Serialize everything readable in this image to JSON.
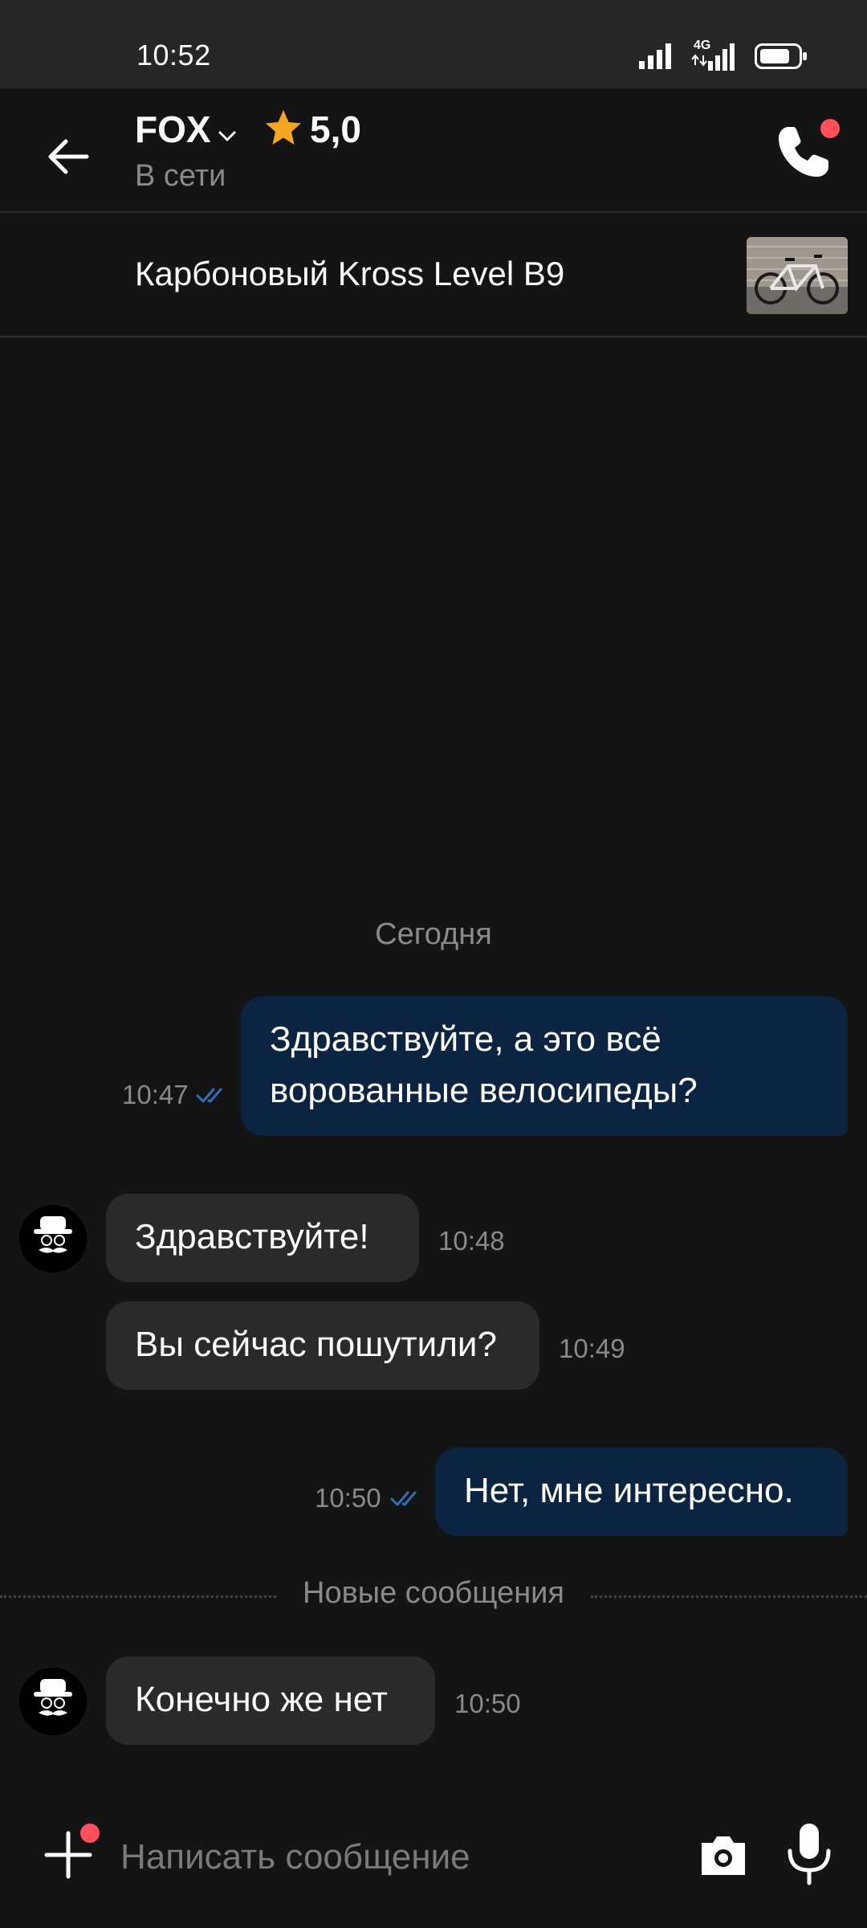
{
  "status_bar": {
    "time": "10:52",
    "network": "4G"
  },
  "header": {
    "seller_name": "FOX",
    "rating": "5,0",
    "status": "В сети",
    "star_color": "#f5a623",
    "notification_dot_color": "#ff4f5a"
  },
  "listing": {
    "title": "Карбоновый Kross Level B9"
  },
  "chat": {
    "day_label": "Сегодня",
    "new_messages_label": "Новые сообщения",
    "messages": [
      {
        "direction": "outgoing",
        "text_line1": "Здравствуйте, а это всё",
        "text_line2": "ворованные велосипеды?",
        "time": "10:47",
        "read": true
      },
      {
        "direction": "incoming",
        "text": "Здравствуйте!",
        "time": "10:48"
      },
      {
        "direction": "incoming",
        "text": "Вы сейчас пошутили?",
        "time": "10:49"
      },
      {
        "direction": "outgoing",
        "text": "Нет, мне интересно.",
        "time": "10:50",
        "read": true
      },
      {
        "direction": "incoming",
        "text": "Конечно же нет",
        "time": "10:50"
      }
    ]
  },
  "composer": {
    "placeholder": "Написать сообщение"
  },
  "icons": [
    "back-arrow-icon",
    "chevron-down-icon",
    "star-icon",
    "phone-icon",
    "plus-icon",
    "camera-icon",
    "microphone-icon",
    "double-check-icon"
  ],
  "colors": {
    "outgoing_bubble": "#0b2442",
    "incoming_bubble": "#2a2a2a",
    "background": "#141414",
    "read_ticks": "#2f6fb5"
  }
}
